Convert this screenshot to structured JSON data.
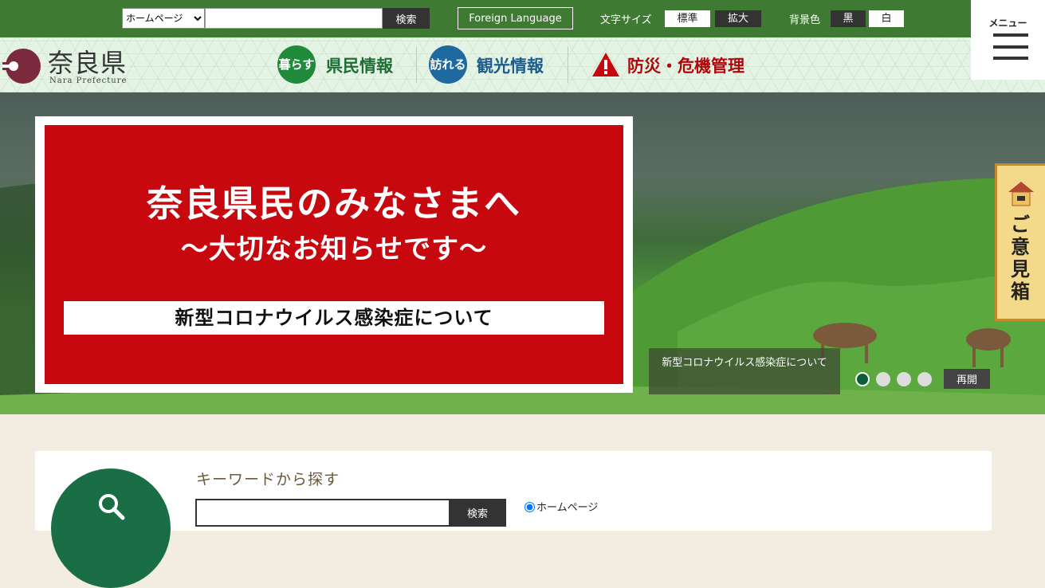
{
  "topbar": {
    "scope_select": {
      "selected": "ホームページ",
      "options": [
        "ホームページ"
      ]
    },
    "search_button": "検索",
    "foreign_language": "Foreign Language",
    "font_size_label": "文字サイズ",
    "font_size_standard": "標準",
    "font_size_large": "拡大",
    "bg_color_label": "背景色",
    "bg_black": "黒",
    "bg_white": "白",
    "menu_label": "メニュー"
  },
  "header": {
    "logo_title": "奈良県",
    "logo_subtitle": "Nara Prefecture",
    "nav": [
      {
        "badge": "暮らす",
        "label": "県民情報",
        "color": "#1f8a3a"
      },
      {
        "badge": "訪れる",
        "label": "観光情報",
        "color": "#1e6aa0"
      },
      {
        "badge": "!",
        "label": "防災・危機管理",
        "color": "#c8080f"
      }
    ]
  },
  "hero": {
    "notice_title": "奈良県民のみなさまへ",
    "notice_subtitle": "～大切なお知らせです～",
    "notice_link": "新型コロナウイルス感染症について",
    "caption": "新型コロナウイルス感染症について",
    "replay_button": "再開",
    "slide_count": 4,
    "active_slide": 1,
    "opinion_box": "ご意見箱"
  },
  "search_section": {
    "heading": "キーワードから探す",
    "button": "検索",
    "radio_homepage": "ホームページ"
  },
  "colors": {
    "topbar": "#3f7a33",
    "accent_red": "#c8080f",
    "logo": "#7b2a3e"
  }
}
